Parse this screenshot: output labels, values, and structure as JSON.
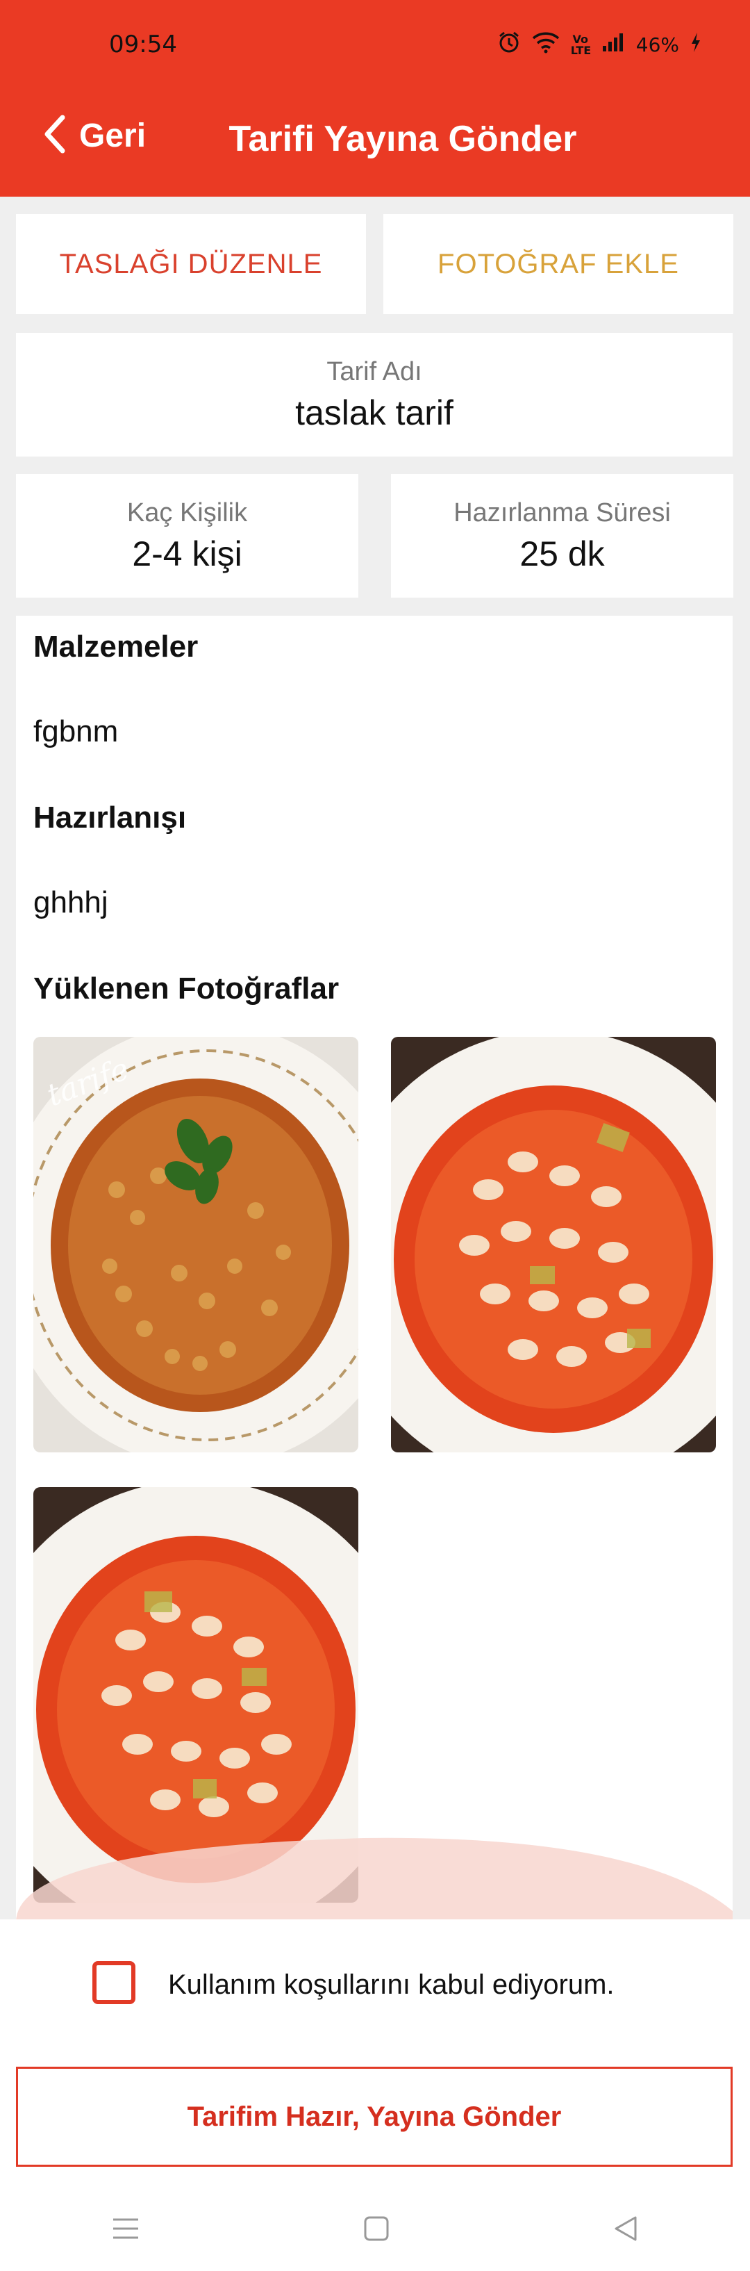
{
  "status": {
    "time": "09:54",
    "battery": "46%",
    "network_badge": "Vo LTE"
  },
  "header": {
    "back_label": "Geri",
    "title": "Tarifi Yayına Gönder"
  },
  "actions": {
    "edit_draft": "TASLAĞI DÜZENLE",
    "add_photo": "FOTOĞRAF EKLE"
  },
  "recipe": {
    "name_label": "Tarif Adı",
    "name_value": "taslak tarif",
    "servings_label": "Kaç Kişilik",
    "servings_value": "2-4 kişi",
    "prep_label": "Hazırlanma Süresi",
    "prep_value": "25 dk"
  },
  "details": {
    "ingredients_title": "Malzemeler",
    "ingredients_text": "fgbnm",
    "preparation_title": "Hazırlanışı",
    "preparation_text": "ghhhj",
    "photos_title": "Yüklenen Fotoğraflar"
  },
  "photos": [
    {
      "name": "kuru fasulye",
      "watermark": "tarife"
    },
    {
      "name": "kuru fasulye"
    },
    {
      "name": "kuru fasulye"
    }
  ],
  "terms": {
    "checkbox_label": "Kullanım koşullarını kabul ediyorum.",
    "checked": false
  },
  "submit": {
    "label": "Tarifim Hazır, Yayına Gönder"
  },
  "colors": {
    "brand": "#ea3a24",
    "edit_text": "#d9412d",
    "photo_text": "#d8a23a"
  }
}
